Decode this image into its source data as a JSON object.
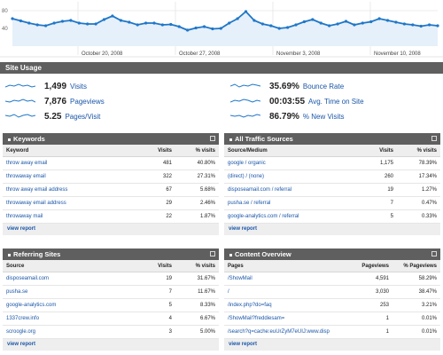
{
  "chart_data": {
    "type": "line",
    "y_tick_labels": [
      "80",
      "40"
    ],
    "x_tick_labels": [
      "October 20, 2008",
      "October 27, 2008",
      "November 3, 2008",
      "November 10, 2008"
    ],
    "ylim": [
      0,
      100
    ],
    "grid": true,
    "series": [
      {
        "values": [
          62,
          57,
          52,
          48,
          46,
          52,
          56,
          58,
          52,
          50,
          50,
          60,
          68,
          58,
          54,
          48,
          52,
          52,
          48,
          49,
          44,
          36,
          41,
          44,
          39,
          40,
          52,
          62,
          78,
          58,
          50,
          46,
          40,
          42,
          48,
          55,
          60,
          52,
          46,
          50,
          56,
          48,
          52,
          55,
          62,
          58,
          54,
          50,
          48,
          45,
          48,
          46
        ]
      }
    ],
    "colors": {
      "line": "#1f77c8",
      "fill": "#e6f0fa",
      "grid": "#dddddd"
    }
  },
  "site_usage": {
    "title": "Site Usage",
    "metrics": [
      {
        "value": "1,499",
        "label": "Visits"
      },
      {
        "value": "7,876",
        "label": "Pageviews"
      },
      {
        "value": "5.25",
        "label": "Pages/Visit"
      },
      {
        "value": "35.69%",
        "label": "Bounce Rate"
      },
      {
        "value": "00:03:55",
        "label": "Avg. Time on Site"
      },
      {
        "value": "86.79%",
        "label": "% New Visits"
      }
    ]
  },
  "panels": {
    "keywords": {
      "title": "Keywords",
      "columns": [
        "Keyword",
        "Visits",
        "% visits"
      ],
      "rows": [
        [
          "throw away email",
          "481",
          "40.80%"
        ],
        [
          "throwaway email",
          "322",
          "27.31%"
        ],
        [
          "throw away email address",
          "67",
          "5.68%"
        ],
        [
          "throwaway email address",
          "29",
          "2.46%"
        ],
        [
          "throwaway mail",
          "22",
          "1.87%"
        ]
      ],
      "view_report": "view report"
    },
    "traffic": {
      "title": "All Traffic Sources",
      "columns": [
        "Source/Medium",
        "Visits",
        "% visits"
      ],
      "rows": [
        [
          "google / organic",
          "1,175",
          "78.39%"
        ],
        [
          "(direct) / (none)",
          "260",
          "17.34%"
        ],
        [
          "disposeamail.com / referral",
          "19",
          "1.27%"
        ],
        [
          "pusha.se / referral",
          "7",
          "0.47%"
        ],
        [
          "google-analytics.com / referral",
          "5",
          "0.33%"
        ]
      ],
      "view_report": "view report"
    },
    "referring": {
      "title": "Referring Sites",
      "columns": [
        "Source",
        "Visits",
        "% visits"
      ],
      "rows": [
        [
          "disposeamail.com",
          "19",
          "31.67%"
        ],
        [
          "pusha.se",
          "7",
          "11.67%"
        ],
        [
          "google-analytics.com",
          "5",
          "8.33%"
        ],
        [
          "1337crew.info",
          "4",
          "6.67%"
        ],
        [
          "scroogle.org",
          "3",
          "5.00%"
        ]
      ],
      "view_report": "view report"
    },
    "content": {
      "title": "Content Overview",
      "columns": [
        "Pages",
        "Pageviews",
        "% Pageviews"
      ],
      "rows": [
        [
          "/ShowMail",
          "4,591",
          "58.29%"
        ],
        [
          "/",
          "3,030",
          "38.47%"
        ],
        [
          "/index.php?do=faq",
          "253",
          "3.21%"
        ],
        [
          "/ShowMail?freddiesam=",
          "1",
          "0.01%"
        ],
        [
          "/search?q=cache:euUrZyM7eUIJ:www.disp",
          "1",
          "0.01%"
        ]
      ],
      "view_report": "view report"
    }
  },
  "colors": {
    "header_bg": "#5f5f5f",
    "link": "#1a56a8",
    "table_header_bg": "#eeeeee"
  }
}
